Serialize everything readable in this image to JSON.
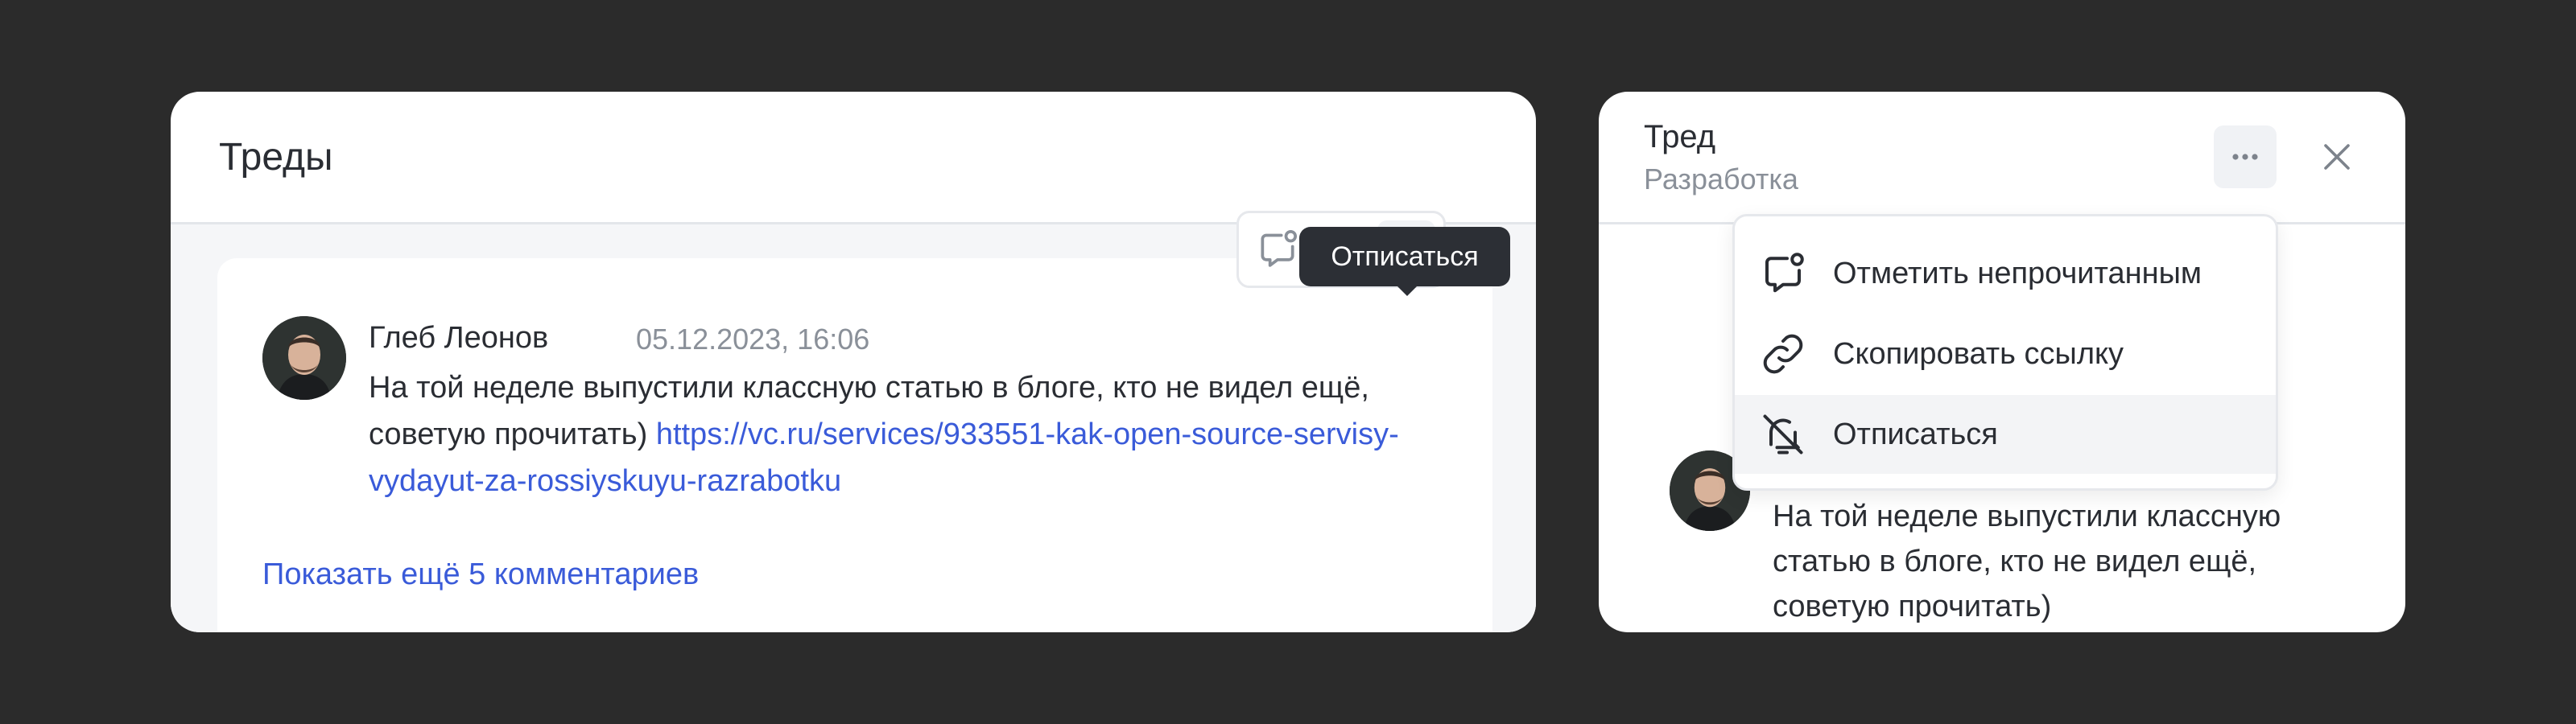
{
  "colors": {
    "background": "#2b2b2b",
    "link": "#3a5bd9",
    "text": "#2a2d33",
    "muted": "#8a9099",
    "tooltip": "#2c2f35"
  },
  "left_panel": {
    "title": "Треды",
    "comment": {
      "author": "Глеб Леонов",
      "timestamp": "05.12.2023, 16:06",
      "text": "На той неделе выпустили классную статью в блоге, кто не видел ещё, советую прочитать)",
      "link": "https://vc.ru/services/933551-kak-open-source-servisy-vydayut-za-rossiyskuyu-razrabotku"
    },
    "show_more": "Показать ещё 5 комментариев",
    "actions": [
      {
        "icon": "mark-unread-icon"
      },
      {
        "icon": "thread-icon"
      },
      {
        "icon": "bell-off-icon"
      }
    ],
    "tooltip": "Отписаться"
  },
  "right_panel": {
    "title": "Тред",
    "subtitle": "Разработка",
    "menu": [
      {
        "label": "Отметить непрочитанным",
        "icon": "mark-unread-icon"
      },
      {
        "label": "Скопировать ссылку",
        "icon": "link-icon"
      },
      {
        "label": "Отписаться",
        "icon": "bell-off-icon"
      }
    ],
    "message_preview": "На той неделе выпустили классную статью в блоге, кто не видел ещё, советую прочитать)"
  }
}
